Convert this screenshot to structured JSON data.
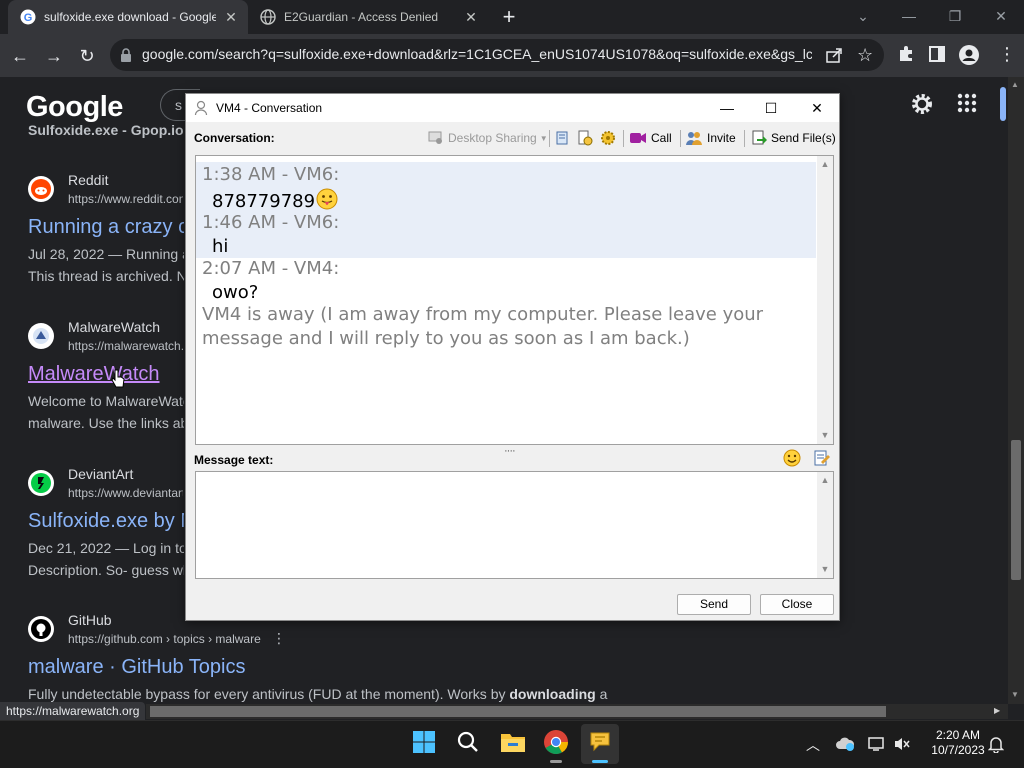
{
  "browser": {
    "tabs": [
      {
        "title": "sulfoxide.exe download - Google",
        "active": true,
        "icon": "google-g-icon"
      },
      {
        "title": "E2Guardian - Access Denied",
        "active": false,
        "icon": "globe-icon"
      }
    ],
    "url_main": "google.com/search?q=sulfoxide.exe+download&rlz=1C1GCEA_enUS1074US1078&oq=sulfoxide.exe&gs_lc...",
    "status_url": "https://malwarewatch.org"
  },
  "page": {
    "logo": "Google",
    "searchbox_stub": "s",
    "partial_top": "Sulfoxide.exe - Gpop.io...",
    "results": [
      {
        "site": "Reddit",
        "url": "https://www.reddit.con",
        "title": "Running a crazy c",
        "snippet1": "Jul 28, 2022 — Running a",
        "snippet2": "This thread is archived. N",
        "icon": "reddit-icon"
      },
      {
        "site": "MalwareWatch",
        "url": "https://malwarewatch.",
        "title": "MalwareWatch",
        "snippet1": "Welcome to MalwareWatc",
        "snippet2": "malware. Use the links ab",
        "icon": "malwarewatch-icon"
      },
      {
        "site": "DeviantArt",
        "url": "https://www.deviantart",
        "title": "Sulfoxide.exe by M",
        "snippet1": "Dec 21, 2022 — Log in to",
        "snippet2": "Description. So- guess wh",
        "icon": "deviantart-icon"
      },
      {
        "site": "GitHub",
        "url": "https://github.com › topics › malware",
        "title": "malware · GitHub Topics",
        "snippet1": "Fully undetectable bypass for every antivirus (FUD at the moment). Works by ",
        "snippet1_bold": "downloading",
        "snippet1_tail": " a",
        "icon": "github-icon"
      }
    ]
  },
  "dialog": {
    "title": "VM4 - Conversation",
    "conversation_label": "Conversation:",
    "toolbar": {
      "desktop_sharing": "Desktop Sharing",
      "call": "Call",
      "invite": "Invite",
      "send_files": "Send File(s)"
    },
    "messages": [
      {
        "header": "1:38 AM - VM6:",
        "body": "878779789"
      },
      {
        "header": "1:46 AM - VM6:",
        "body": "hi"
      },
      {
        "header": "2:07 AM - VM4:",
        "body": "owo?"
      }
    ],
    "away_notice": "VM4 is away (I am away from my computer. Please leave your message and I will reply to you as soon as I am back.)",
    "message_label": "Message text:",
    "send_button": "Send",
    "close_button": "Close"
  },
  "taskbar": {
    "time": "2:20 AM",
    "date": "10/7/2023"
  },
  "colors": {
    "link_blue": "#8ab4f8",
    "visited_purple": "#c58af9",
    "page_bg": "#202124"
  }
}
